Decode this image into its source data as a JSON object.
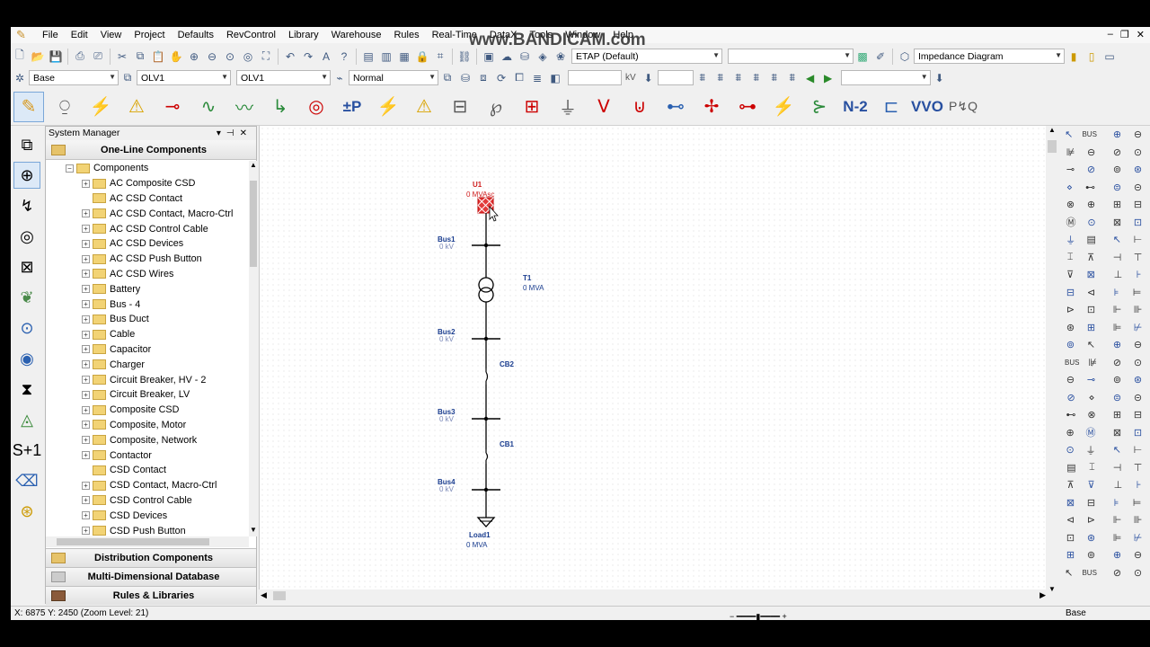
{
  "watermark": "www.BANDICAM.com",
  "menubar": {
    "items": [
      "File",
      "Edit",
      "View",
      "Project",
      "Defaults",
      "RevControl",
      "Library",
      "Warehouse",
      "Rules",
      "Real-Time",
      "DataX",
      "Tools",
      "Window",
      "Help"
    ]
  },
  "toolbar1": {
    "library_combo": "ETAP (Default)",
    "view_combo": "Impedance Diagram"
  },
  "toolbar2": {
    "config_combo": "Base",
    "presentation_combo": "OLV1",
    "study_combo": "OLV1",
    "mode_combo": "Normal",
    "kv_label": "kV"
  },
  "toolbar3": {
    "buttons": [
      "pencil",
      "power-grid",
      "generator",
      "fault",
      "switch",
      "wave",
      "harmonic",
      "relay",
      "ct",
      "+P",
      "load-flow",
      "lightning",
      "battery",
      "PQ",
      "PQ-chart",
      "ground",
      "V-curve",
      "motor-curve",
      "connector",
      "cross",
      "breaker",
      "tcc",
      "switching",
      "N-2",
      "train",
      "VVO",
      "PVQ"
    ],
    "plus_p_label": "±P",
    "n2_label": "N-2",
    "vvo_label": "VVO"
  },
  "system_manager": {
    "title": "System Manager",
    "header": "One-Line Components",
    "root": "Components",
    "items": [
      {
        "label": "AC Composite CSD",
        "expand": true
      },
      {
        "label": "AC CSD Contact",
        "expand": false
      },
      {
        "label": "AC CSD Contact, Macro-Ctrl",
        "expand": true
      },
      {
        "label": "AC CSD Control Cable",
        "expand": true
      },
      {
        "label": "AC CSD Devices",
        "expand": true
      },
      {
        "label": "AC CSD Push Button",
        "expand": true
      },
      {
        "label": "AC CSD Wires",
        "expand": true
      },
      {
        "label": "Battery",
        "expand": true
      },
      {
        "label": "Bus - 4",
        "expand": true
      },
      {
        "label": "Bus Duct",
        "expand": true
      },
      {
        "label": "Cable",
        "expand": true
      },
      {
        "label": "Capacitor",
        "expand": true
      },
      {
        "label": "Charger",
        "expand": true
      },
      {
        "label": "Circuit Breaker, HV - 2",
        "expand": true
      },
      {
        "label": "Circuit Breaker, LV",
        "expand": true
      },
      {
        "label": "Composite CSD",
        "expand": true
      },
      {
        "label": "Composite, Motor",
        "expand": true
      },
      {
        "label": "Composite, Network",
        "expand": true
      },
      {
        "label": "Contactor",
        "expand": true
      },
      {
        "label": "CSD Contact",
        "expand": false
      },
      {
        "label": "CSD Contact, Macro-Ctrl",
        "expand": true
      },
      {
        "label": "CSD Control Cable",
        "expand": true
      },
      {
        "label": "CSD Devices",
        "expand": true
      },
      {
        "label": "CSD Push Button",
        "expand": true
      }
    ],
    "bottom_sections": [
      "Distribution Components",
      "Multi-Dimensional Database",
      "Rules & Libraries"
    ]
  },
  "diagram": {
    "utility": {
      "name": "U1",
      "rating": "0 MVAsc"
    },
    "buses": [
      {
        "name": "Bus1",
        "kv": "0 kV"
      },
      {
        "name": "Bus2",
        "kv": "0 kV"
      },
      {
        "name": "Bus3",
        "kv": "0 kV"
      },
      {
        "name": "Bus4",
        "kv": "0 kV"
      }
    ],
    "transformer": {
      "name": "T1",
      "rating": "0 MVA"
    },
    "breakers": [
      "CB2",
      "CB1"
    ],
    "load": {
      "name": "Load1",
      "rating": "0 MVA"
    }
  },
  "status": {
    "coords": "X: 6875     Y: 2450 (Zoom Level: 21)",
    "config": "Base"
  },
  "colors": {
    "element_blue": "#1a3d8f",
    "utility_red": "#d02020",
    "bus_sub": "#7a88b8"
  }
}
